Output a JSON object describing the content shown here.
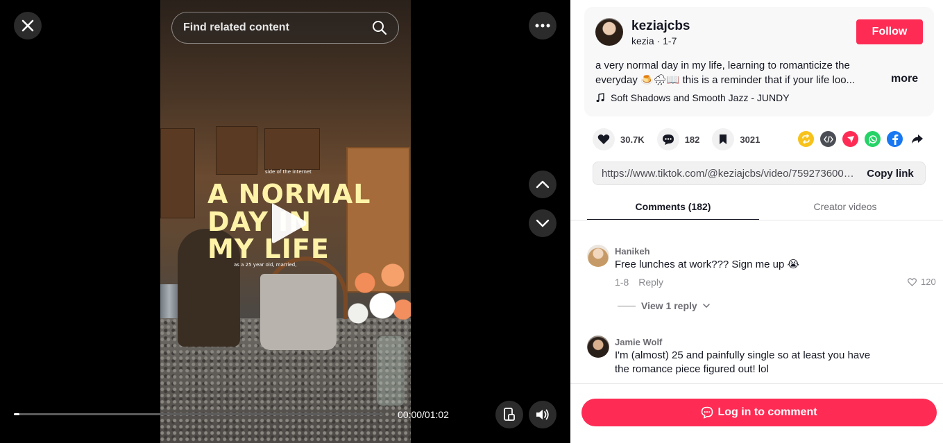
{
  "video": {
    "search_placeholder": "Find related content",
    "overlay_small_top": "side of the internet",
    "overlay_line1": "A NORMAL",
    "overlay_line2": "DAY IN",
    "overlay_line3": "MY LIFE",
    "overlay_small_bottom": "as a 25 year old, married,",
    "time": "00:00/01:02",
    "progress": 0.015
  },
  "author": {
    "username": "keziajcbs",
    "subname": "kezia · 1-7",
    "follow_label": "Follow"
  },
  "description": {
    "line1": "a very normal day in my life, learning to romanticize the",
    "line2": "everyday 🍮🌧📖 this is a reminder that if your life loo...",
    "more_label": "more",
    "music": "Soft Shadows and Smooth Jazz - JUNDY"
  },
  "stats": {
    "likes": "30.7K",
    "comments": "182",
    "saves": "3021"
  },
  "share": {
    "icons": [
      "repost-icon",
      "embed-icon",
      "send-icon",
      "whatsapp-icon",
      "facebook-icon",
      "share-arrow-icon"
    ],
    "colors": {
      "repost": "#f7c21b",
      "embed": "#4b4f55",
      "send": "#fe2c55",
      "whatsapp": "#25d366",
      "facebook": "#1877f2"
    }
  },
  "link": {
    "url": "https://www.tiktok.com/@keziajcbs/video/7592736002...",
    "copy_label": "Copy link"
  },
  "tabs": [
    {
      "label": "Comments (182)",
      "active": true
    },
    {
      "label": "Creator videos",
      "active": false
    }
  ],
  "comments": [
    {
      "name": "Hanikeh",
      "text": "Free lunches at work??? Sign me up 😭",
      "date": "1-8",
      "reply_label": "Reply",
      "likes": "120",
      "view_replies": "View 1 reply"
    },
    {
      "name": "Jamie Wolf",
      "text": "I'm (almost) 25 and painfully single so at least you have the romance piece figured out! lol"
    }
  ],
  "login_label": "Log in to comment",
  "colors": {
    "accent": "#fe2c55",
    "text": "#161823"
  }
}
